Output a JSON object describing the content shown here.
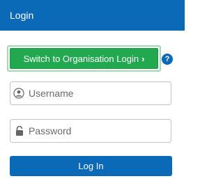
{
  "header": {
    "title": "Login"
  },
  "switch_button": {
    "label": "Switch to Organisation Login",
    "chevron": "›"
  },
  "help": {
    "glyph": "?"
  },
  "username": {
    "placeholder": "Username",
    "icon": "user-icon"
  },
  "password": {
    "placeholder": "Password",
    "icon": "lock-icon"
  },
  "login_button": {
    "label": "Log In"
  },
  "colors": {
    "primary": "#0b6ab8",
    "success": "#22a84f",
    "success_outline": "#9fd9b1",
    "field_border": "#c3c3c3"
  }
}
